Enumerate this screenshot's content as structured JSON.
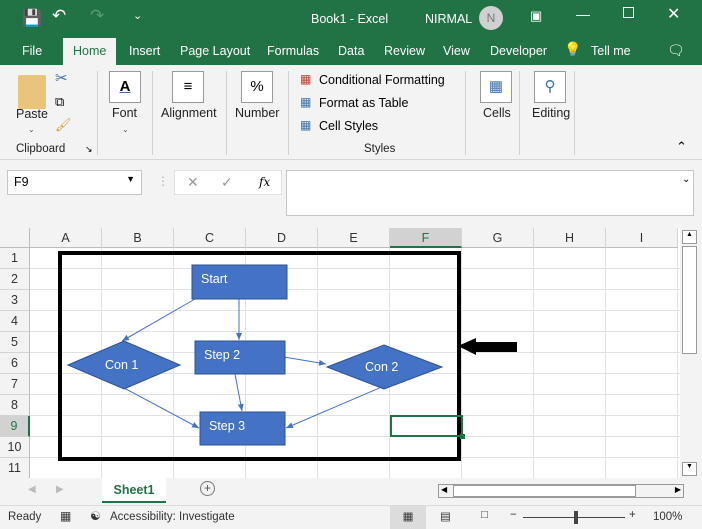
{
  "window": {
    "title": "Book1  -  Excel",
    "user": "NIRMAL",
    "avatar_initial": "N"
  },
  "tabs": [
    "File",
    "Home",
    "Insert",
    "Page Layout",
    "Formulas",
    "Data",
    "Review",
    "View",
    "Developer",
    "Tell me"
  ],
  "ribbon": {
    "paste": "Paste",
    "clipboard": "Clipboard",
    "font": "Font",
    "alignment": "Alignment",
    "number": "Number",
    "number_icon": "%",
    "font_icon": "A",
    "conditional": "Conditional Formatting",
    "format_table": "Format as Table",
    "cell_styles": "Cell Styles",
    "styles": "Styles",
    "cells": "Cells",
    "editing": "Editing"
  },
  "formula_bar": {
    "name_box": "F9",
    "fx": "fx",
    "value": ""
  },
  "columns": [
    "A",
    "B",
    "C",
    "D",
    "E",
    "F",
    "G",
    "H",
    "I"
  ],
  "rows": [
    "1",
    "2",
    "3",
    "4",
    "5",
    "6",
    "7",
    "8",
    "9",
    "10",
    "11"
  ],
  "selected_cell": "F9",
  "shapes": {
    "start": "Start",
    "step2": "Step 2",
    "step3": "Step 3",
    "con1": "Con 1",
    "con2": "Con 2"
  },
  "colors": {
    "accent": "#217346",
    "shape_fill": "#4472c4"
  },
  "sheet_tab": "Sheet1",
  "status": {
    "ready": "Ready",
    "accessibility": "Accessibility: Investigate",
    "zoom": "100%"
  }
}
